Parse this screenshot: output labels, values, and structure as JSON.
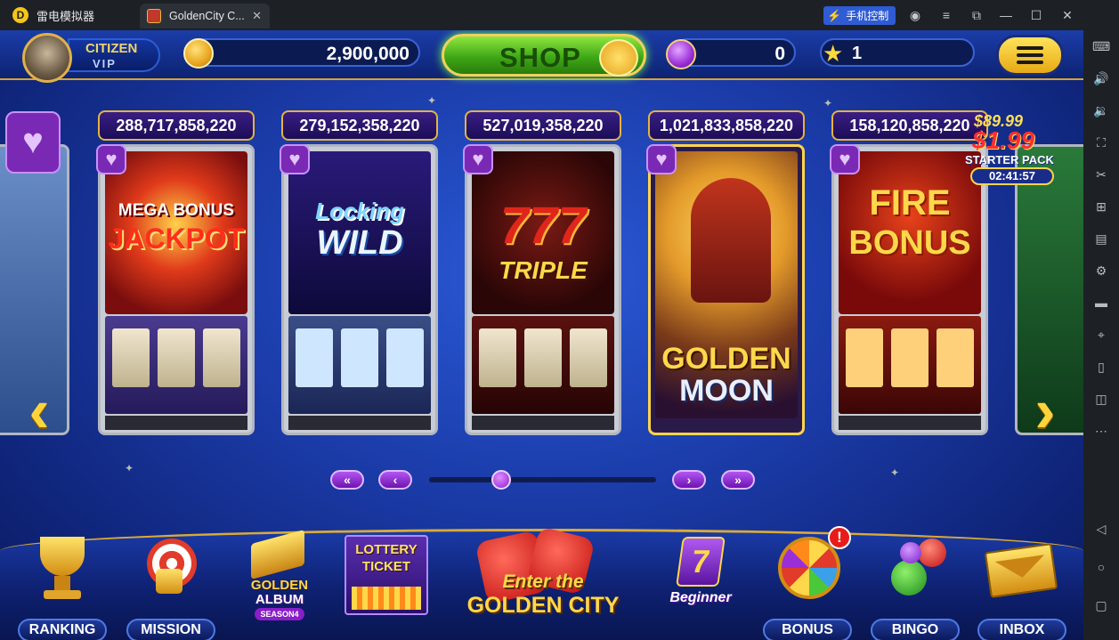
{
  "titlebar": {
    "app_name": "雷电模拟器",
    "tab_title": "GoldenCity C...",
    "phone_control": "手机控制"
  },
  "hud": {
    "vip_title": "CITIZEN",
    "vip_level": "VIP",
    "coins": "2,900,000",
    "shop_label": "SHOP",
    "gems": "0",
    "stars": "1"
  },
  "machines": [
    {
      "jackpot": "288,717,858,220",
      "title_line1": "MEGA BONUS",
      "title_line2": "JACKPOT"
    },
    {
      "jackpot": "279,152,358,220",
      "title_line1": "Locking",
      "title_line2": "WILD"
    },
    {
      "jackpot": "527,019,358,220",
      "title_line1": "777",
      "title_line2": "TRIPLE"
    },
    {
      "jackpot": "1,021,833,858,220",
      "title_line1": "GOLDEN",
      "title_line2": "MOON"
    },
    {
      "jackpot": "158,120,858,220",
      "title_line1": "FIRE",
      "title_line2": "BONUS"
    }
  ],
  "promo": {
    "old_price": "$89.99",
    "new_price": "$1.99",
    "label": "STARTER PACK",
    "timer": "02:41:57"
  },
  "pagination": {
    "first": "«",
    "prev": "‹",
    "next": "›",
    "last": "»",
    "position": 0.3
  },
  "nav": {
    "ranking": "RANKING",
    "mission": "MISSION",
    "album_line1": "GOLDEN",
    "album_line2": "ALBUM",
    "album_season": "SEASON4",
    "lottery_line1": "LOTTERY",
    "lottery_line2": "TICKET",
    "center_sub": "Enter the",
    "center_label": "GOLDEN CITY",
    "beginner": "Beginner",
    "bonus": "BONUS",
    "bonus_notify": "!",
    "bingo": "BINGO",
    "inbox": "INBOX"
  },
  "icons": {
    "heart": "♥",
    "star": "★",
    "left_arrow": "‹",
    "right_arrow": "›"
  },
  "colors": {
    "accent_gold": "#d6a431",
    "background_blue": "#1a3aa6",
    "shop_green": "#3fa817",
    "gem_purple": "#9a2fd8"
  }
}
